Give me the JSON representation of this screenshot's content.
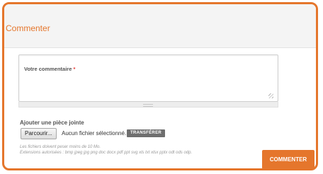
{
  "form": {
    "title": "Commenter",
    "comment_field": {
      "label": "Votre commentaire",
      "required_marker": "*",
      "value": ""
    },
    "attachment": {
      "label": "Ajouter une pièce jointe",
      "browse_label": "Parcourir...",
      "file_status": "Aucun fichier sélectionné.",
      "transfer_label": "TRANSFÉRER",
      "hint_size": "Les fichiers doivent peser moins de 10 Mo.",
      "hint_extensions": "Extensions autorisées : bmp jpeg jpg png doc docx pdf ppt svg xls txt xlsx pptx odt ods odp."
    },
    "submit_label": "COMMENTER"
  },
  "colors": {
    "accent": "#e5762c",
    "header_bg": "#f4f4f4",
    "transfer_button_bg": "#6e6e6e"
  }
}
